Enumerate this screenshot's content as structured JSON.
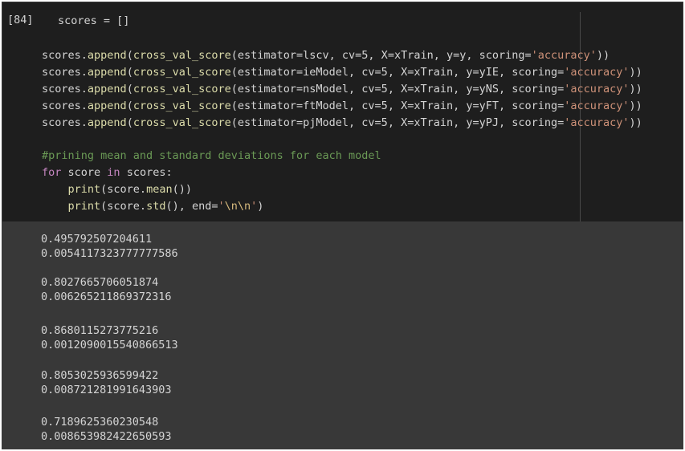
{
  "cell": {
    "execution_count": "[84]",
    "code": {
      "line1": {
        "var": "scores",
        "op": " = ",
        "val": "[]"
      },
      "appends": [
        {
          "pre": "scores.",
          "fn": "append",
          "mid1": "(",
          "fn2": "cross_val_score",
          "args": "(estimator=lscv, cv=5, X=xTrain, y=y, scoring=",
          "str": "'accuracy'",
          "end": "))"
        },
        {
          "pre": "scores.",
          "fn": "append",
          "mid1": "(",
          "fn2": "cross_val_score",
          "args": "(estimator=ieModel, cv=5, X=xTrain, y=yIE, scoring=",
          "str": "'accuracy'",
          "end": "))"
        },
        {
          "pre": "scores.",
          "fn": "append",
          "mid1": "(",
          "fn2": "cross_val_score",
          "args": "(estimator=nsModel, cv=5, X=xTrain, y=yNS, scoring=",
          "str": "'accuracy'",
          "end": "))"
        },
        {
          "pre": "scores.",
          "fn": "append",
          "mid1": "(",
          "fn2": "cross_val_score",
          "args": "(estimator=ftModel, cv=5, X=xTrain, y=yFT, scoring=",
          "str": "'accuracy'",
          "end": "))"
        },
        {
          "pre": "scores.",
          "fn": "append",
          "mid1": "(",
          "fn2": "cross_val_score",
          "args": "(estimator=pjModel, cv=5, X=xTrain, y=yPJ, scoring=",
          "str": "'accuracy'",
          "end": "))"
        }
      ],
      "comment": "#prining mean and standard deviations for each model",
      "for_kw": "for",
      "for_rest": " score ",
      "in_kw": "in",
      "for_end": " scores:",
      "print1": {
        "indent": "    ",
        "fn": "print",
        "rest": "(score.",
        "fn2": "mean",
        "end": "())"
      },
      "print2": {
        "indent": "    ",
        "fn": "print",
        "rest": "(score.",
        "fn2": "std",
        "mid": "(), end=",
        "str1": "'",
        "esc": "\\n\\n",
        "str2": "'",
        "end": ")"
      }
    },
    "output": {
      "lines": [
        "0.495792507204611",
        "0.0054117323777777586",
        "",
        "0.8027665706051874",
        "0.006265211869372316",
        "",
        "0.8680115273775216",
        "0.0012090015540866513",
        "",
        "0.8053025936599422",
        "0.008721281991643903",
        "",
        "0.7189625360230548",
        "0.008653982422650593"
      ]
    }
  }
}
